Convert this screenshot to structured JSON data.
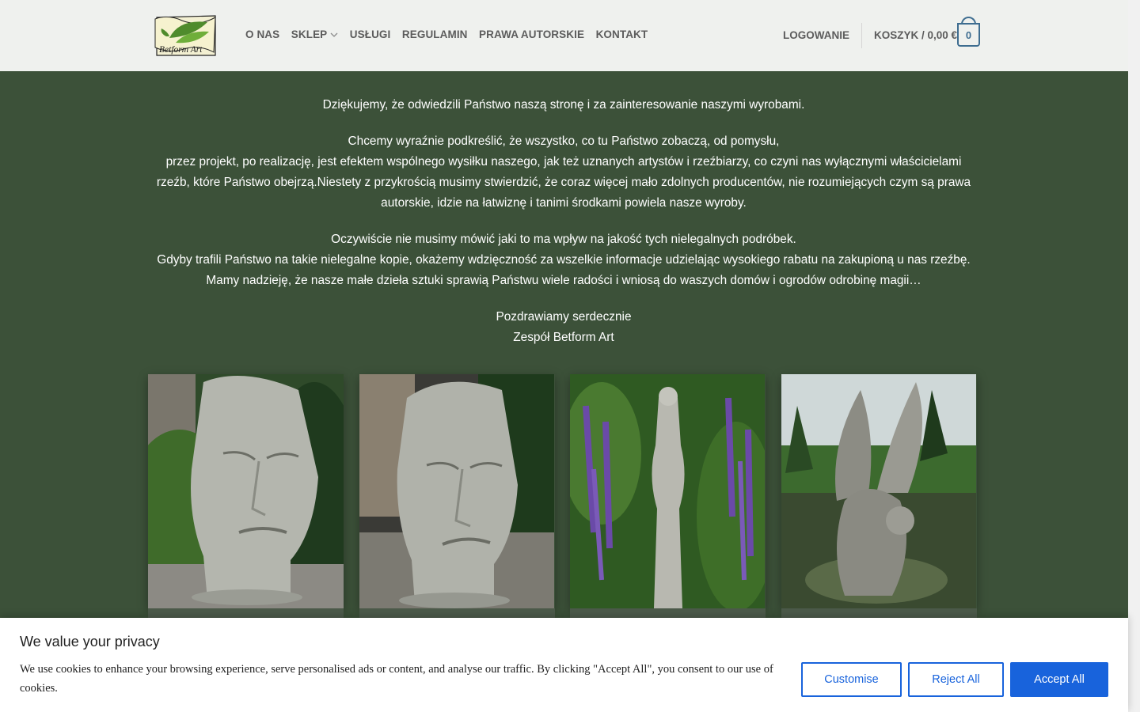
{
  "header": {
    "logo_text": "Betform Art",
    "nav": [
      {
        "label": "O NAS"
      },
      {
        "label": "SKLEP"
      },
      {
        "label": "USŁUGI"
      },
      {
        "label": "REGULAMIN"
      },
      {
        "label": "PRAWA AUTORSKIE"
      },
      {
        "label": "KONTAKT"
      }
    ],
    "login": "LOGOWANIE",
    "cart_label": "KOSZYK / 0,00 €",
    "cart_count": "0"
  },
  "main": {
    "p1": "Dziękujemy, że odwiedzili Państwo naszą stronę i za zainteresowanie naszymi wyrobami.",
    "p2_l1": "Chcemy wyraźnie podkreślić, że wszystko, co tu Państwo zobaczą, od pomysłu,",
    "p2_l2": "przez projekt, po realizację, jest efektem wspólnego wysiłku naszego, jak też uznanych artystów i rzeźbiarzy, co czyni nas wyłącznymi właścicielami rzeźb, które Państwo obejrzą.Niestety z przykrością musimy stwierdzić, że coraz więcej mało zdolnych producentów, nie rozumiejących czym są prawa autorskie, idzie na łatwiznę i tanimi środkami powiela nasze wyroby.",
    "p3_l1": "Oczywiście nie musimy mówić jaki to ma wpływ na jakość tych nielegalnych podróbek.",
    "p3_l2": "Gdyby trafili Państwo na takie nielegalne kopie, okażemy wdzięczność za wszelkie informacje udzielając wysokiego rabatu na zakupioną u nas rzeźbę.",
    "p3_l3": "Mamy nadzieję, że nasze małe dzieła sztuki sprawią Państwu wiele radości i wniosą do waszych domów i ogrodów odrobinę magii…",
    "p4_l1": "Pozdrawiamy serdecznie",
    "p4_l2": "Zespół Betform Art"
  },
  "cookie": {
    "title": "We value your privacy",
    "text": "We use cookies to enhance your browsing experience, serve personalised ads or content, and analyse our traffic. By clicking \"Accept All\", you consent to our use of cookies.",
    "customise": "Customise",
    "reject": "Reject All",
    "accept": "Accept All"
  }
}
